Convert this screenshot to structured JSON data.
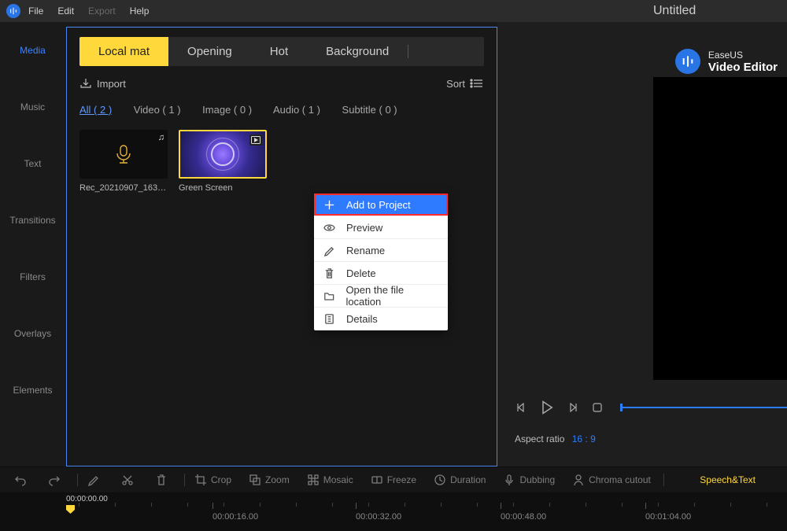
{
  "menubar": {
    "file": "File",
    "edit": "Edit",
    "export": "Export",
    "help": "Help"
  },
  "title": "Untitled",
  "brand": {
    "name": "EaseUS",
    "product": "Video Editor"
  },
  "sidebar": {
    "items": [
      {
        "label": "Media"
      },
      {
        "label": "Music"
      },
      {
        "label": "Text"
      },
      {
        "label": "Transitions"
      },
      {
        "label": "Filters"
      },
      {
        "label": "Overlays"
      },
      {
        "label": "Elements"
      }
    ]
  },
  "library": {
    "tabs": [
      {
        "label": "Local mat"
      },
      {
        "label": "Opening"
      },
      {
        "label": "Hot"
      },
      {
        "label": "Background"
      }
    ],
    "import": "Import",
    "sort": "Sort",
    "filters": [
      {
        "label": "All ( 2 )"
      },
      {
        "label": "Video ( 1 )"
      },
      {
        "label": "Image ( 0 )"
      },
      {
        "label": "Audio ( 1 )"
      },
      {
        "label": "Subtitle ( 0 )"
      }
    ],
    "clips": [
      {
        "name": "Rec_20210907_1635..."
      },
      {
        "name": "Green Screen"
      }
    ]
  },
  "context_menu": {
    "items": [
      {
        "label": "Add to Project"
      },
      {
        "label": "Preview"
      },
      {
        "label": "Rename"
      },
      {
        "label": "Delete"
      },
      {
        "label": "Open the file location"
      },
      {
        "label": "Details"
      }
    ]
  },
  "playbar": {
    "aspect_label": "Aspect ratio",
    "aspect_value": "16 : 9"
  },
  "toolbar": {
    "crop": "Crop",
    "zoom": "Zoom",
    "mosaic": "Mosaic",
    "freeze": "Freeze",
    "duration": "Duration",
    "dubbing": "Dubbing",
    "chroma": "Chroma cutout",
    "speech": "Speech&Text"
  },
  "timeline": {
    "playhead": "00:00:00.00",
    "ticks": [
      "00:00:16.00",
      "00:00:32.00",
      "00:00:48.00",
      "00:01:04.00"
    ]
  },
  "colors": {
    "accent": "#ffd93b",
    "primary": "#2b7fff",
    "highlight": "#ff2a2a"
  }
}
